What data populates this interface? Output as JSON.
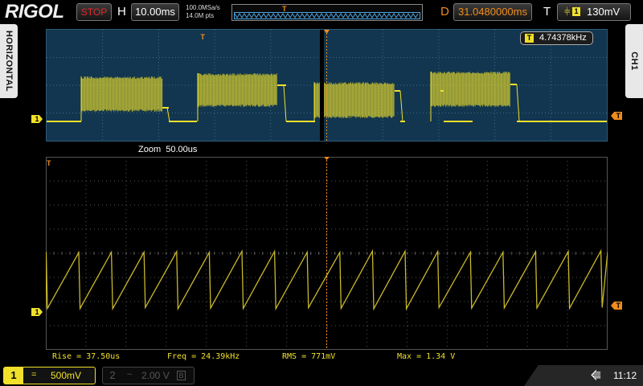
{
  "brand": "RIGOL",
  "run_state": "STOP",
  "horizontal": {
    "label": "H",
    "timebase": "10.00ms"
  },
  "acquisition": {
    "sample_rate": "100.0MSa/s",
    "memory_depth": "14.0M pts"
  },
  "delay": {
    "label": "D",
    "value": "31.0480000ms"
  },
  "trigger": {
    "label": "T",
    "channel": "1",
    "edge_icon": "falling-edge-icon",
    "level": "130mV"
  },
  "left_tab": "HORIZONTAL",
  "right_tab": "CH1",
  "freq_counter": {
    "channel": "T",
    "value": "4.74378kHz"
  },
  "zoom": {
    "label": "Zoom",
    "timebase": "50.00us"
  },
  "markers": {
    "channel": "1",
    "trigger": "T"
  },
  "measurements": [
    {
      "label": "Rise",
      "value": "37.50us"
    },
    {
      "label": "Freq",
      "value": "24.39kHz"
    },
    {
      "label": "RMS",
      "value": "771mV"
    },
    {
      "label": "Max",
      "value": "1.34 V"
    }
  ],
  "channels": [
    {
      "number": "1",
      "coupling": "=",
      "scale": "500mV",
      "active": true
    },
    {
      "number": "2",
      "coupling": "~",
      "scale": "2.00 V",
      "bw_label": "B",
      "active": false
    }
  ],
  "status": {
    "usb_icon": "usb-icon",
    "time": "11:12"
  },
  "colors": {
    "ch1": "#f0e02a",
    "trigger": "#f08c1c",
    "stop": "#e32a2a",
    "overview_bg": "#12364f"
  }
}
